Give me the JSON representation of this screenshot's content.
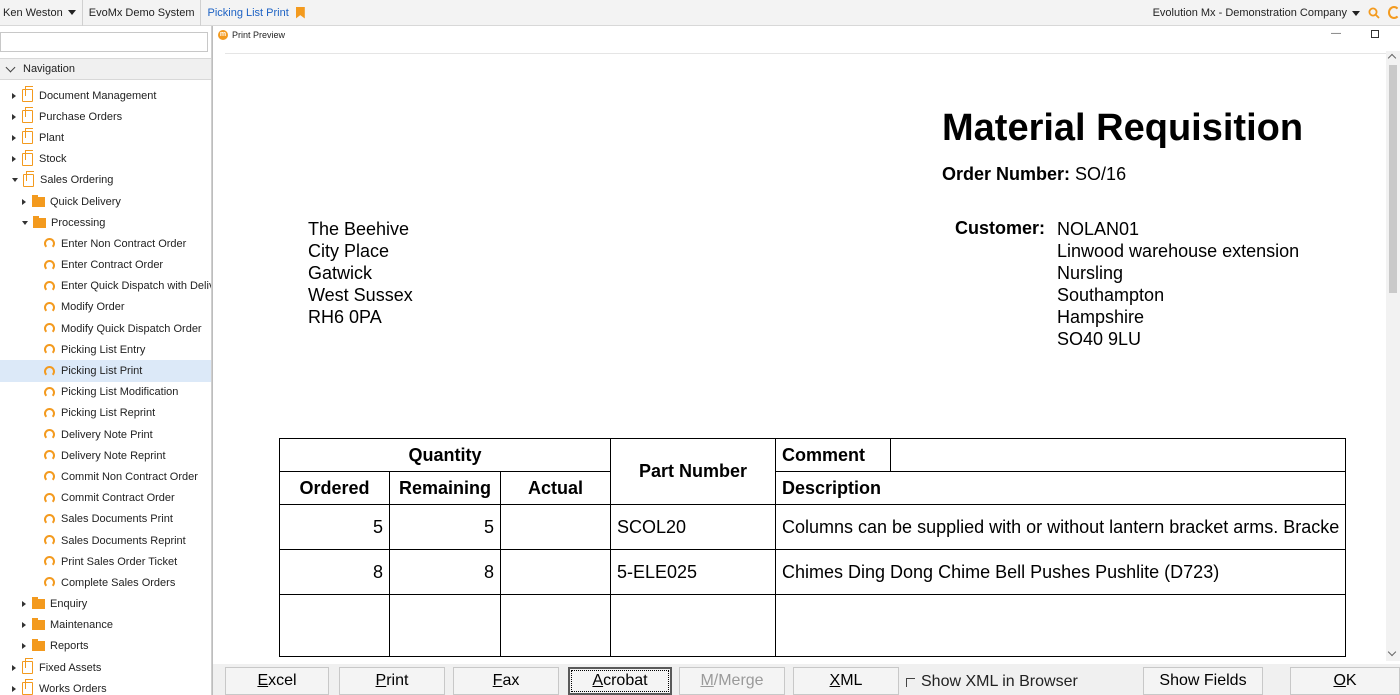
{
  "topbar": {
    "user": "Ken Weston",
    "system": "EvoMx Demo System",
    "active_tab": "Picking List Print",
    "company": "Evolution Mx - Demonstration Company"
  },
  "nav": {
    "title": "Navigation",
    "items": [
      {
        "label": "Document Management",
        "level": 0,
        "icon": "document-icon",
        "expand": "collapsed"
      },
      {
        "label": "Purchase Orders",
        "level": 0,
        "icon": "document-icon",
        "expand": "collapsed"
      },
      {
        "label": "Plant",
        "level": 0,
        "icon": "document-icon",
        "expand": "collapsed"
      },
      {
        "label": "Stock",
        "level": 0,
        "icon": "document-icon",
        "expand": "collapsed"
      },
      {
        "label": "Sales Ordering",
        "level": 0,
        "icon": "document-icon",
        "expand": "expanded"
      },
      {
        "label": "Quick Delivery",
        "level": 1,
        "icon": "folder-icon",
        "expand": "collapsed"
      },
      {
        "label": "Processing",
        "level": 1,
        "icon": "folder-icon",
        "expand": "expanded"
      },
      {
        "label": "Enter Non Contract Order",
        "level": 2,
        "icon": "task-icon"
      },
      {
        "label": "Enter Contract Order",
        "level": 2,
        "icon": "task-icon"
      },
      {
        "label": "Enter Quick Dispatch with Deliv...",
        "level": 2,
        "icon": "task-icon"
      },
      {
        "label": "Modify Order",
        "level": 2,
        "icon": "task-icon"
      },
      {
        "label": "Modify Quick Dispatch Order",
        "level": 2,
        "icon": "task-icon"
      },
      {
        "label": "Picking List Entry",
        "level": 2,
        "icon": "task-icon"
      },
      {
        "label": "Picking List Print",
        "level": 2,
        "icon": "task-icon",
        "selected": true
      },
      {
        "label": "Picking List Modification",
        "level": 2,
        "icon": "task-icon"
      },
      {
        "label": "Picking List Reprint",
        "level": 2,
        "icon": "task-icon"
      },
      {
        "label": "Delivery Note Print",
        "level": 2,
        "icon": "task-icon"
      },
      {
        "label": "Delivery Note Reprint",
        "level": 2,
        "icon": "task-icon"
      },
      {
        "label": "Commit Non Contract Order",
        "level": 2,
        "icon": "task-icon"
      },
      {
        "label": "Commit Contract Order",
        "level": 2,
        "icon": "task-icon"
      },
      {
        "label": "Sales Documents Print",
        "level": 2,
        "icon": "task-icon"
      },
      {
        "label": "Sales Documents Reprint",
        "level": 2,
        "icon": "task-icon"
      },
      {
        "label": "Print Sales Order Ticket",
        "level": 2,
        "icon": "task-icon"
      },
      {
        "label": "Complete Sales Orders",
        "level": 2,
        "icon": "task-icon"
      },
      {
        "label": "Enquiry",
        "level": 1,
        "icon": "folder-icon",
        "expand": "collapsed"
      },
      {
        "label": "Maintenance",
        "level": 1,
        "icon": "folder-icon",
        "expand": "collapsed"
      },
      {
        "label": "Reports",
        "level": 1,
        "icon": "folder-icon",
        "expand": "collapsed"
      },
      {
        "label": "Fixed Assets",
        "level": 0,
        "icon": "document-icon",
        "expand": "collapsed"
      },
      {
        "label": "Works Orders",
        "level": 0,
        "icon": "document-icon",
        "expand": "collapsed"
      }
    ]
  },
  "preview": {
    "window_title": "Print Preview",
    "doc_title": "Material Requisition",
    "order_label": "Order Number:",
    "order_value": "SO/16",
    "address": [
      "The Beehive",
      "City Place",
      "Gatwick",
      "West Sussex",
      "RH6 0PA"
    ],
    "customer_label": "Customer:",
    "customer_lines": [
      "NOLAN01",
      "Linwood warehouse extension",
      "Nursling",
      "Southampton",
      "Hampshire",
      "SO40 9LU"
    ],
    "table": {
      "quantity_header": "Quantity",
      "ordered_header": "Ordered",
      "remaining_header": "Remaining",
      "actual_header": "Actual",
      "part_header": "Part Number",
      "comment_header": "Comment",
      "description_header": "Description",
      "rows": [
        {
          "ordered": "5",
          "remaining": "5",
          "actual": "",
          "part": "SCOL20",
          "description": "Columns can be supplied with or without lantern bracket arms. Bracke"
        },
        {
          "ordered": "8",
          "remaining": "8",
          "actual": "",
          "part": "5-ELE025",
          "description": "Chimes Ding Dong Chime Bell Pushes Pushlite (D723)"
        }
      ]
    }
  },
  "buttons": {
    "excel": {
      "key": "E",
      "rest": "xcel"
    },
    "print": {
      "key": "P",
      "rest": "rint"
    },
    "fax": {
      "key": "F",
      "rest": "ax"
    },
    "acrobat": {
      "key": "A",
      "rest": "crobat"
    },
    "mmerge": {
      "key": "M",
      "rest": "/Merge"
    },
    "xml": {
      "key": "X",
      "rest": "ML"
    },
    "show_xml": "Show XML in Browser",
    "show_fields": "Show Fields",
    "ok": {
      "key": "O",
      "rest": "K"
    }
  },
  "colors": {
    "accent": "#f39a1e",
    "active_tab": "#1d62c4",
    "selection": "#dce9f8"
  }
}
